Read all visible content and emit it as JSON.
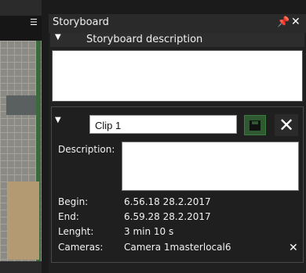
{
  "panel": {
    "title": "Storyboard",
    "pin_icon": "pin-icon",
    "close_icon": "close-icon"
  },
  "description_section": {
    "label": "Storyboard description",
    "value": ""
  },
  "clip": {
    "name": "Clip 1",
    "description_label": "Description:",
    "description_value": "",
    "begin_label": "Begin:",
    "begin_value": "6.56.18 28.2.2017",
    "end_label": "End:",
    "end_value": "6.59.28 28.2.2017",
    "length_label": "Lenght:",
    "length_value": "3 min 10 s",
    "cameras_label": "Cameras:",
    "cameras_value": "Camera 1masterlocal6"
  },
  "colors": {
    "panel_bg": "#202020",
    "accent_green": "#2f5a31"
  }
}
